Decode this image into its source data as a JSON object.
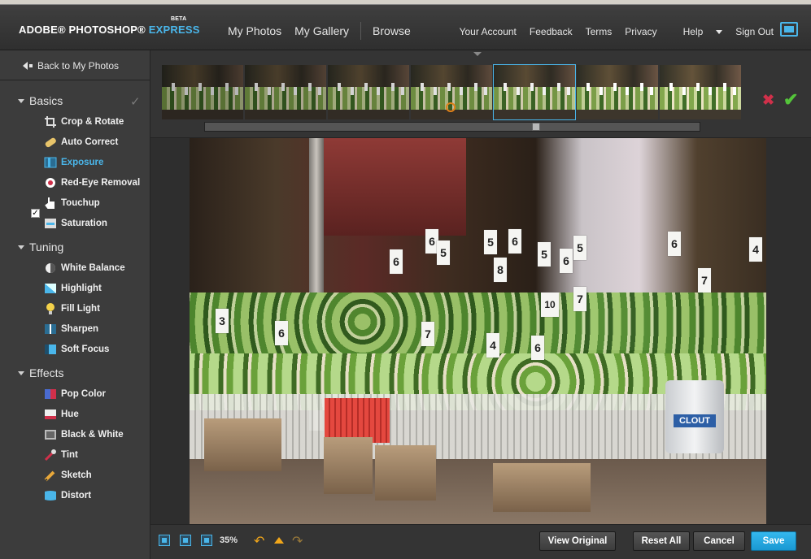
{
  "header": {
    "logo_main": "ADOBE® PHOTOSHOP®",
    "logo_express": "EXPRESS",
    "logo_beta": "BETA",
    "nav": [
      "My Photos",
      "My Gallery",
      "Browse"
    ],
    "links": [
      "Your Account",
      "Feedback",
      "Terms",
      "Privacy",
      "Help",
      "Sign Out"
    ]
  },
  "sidebar": {
    "back": "Back to My Photos",
    "sections": [
      {
        "title": "Basics",
        "tools": [
          "Crop & Rotate",
          "Auto Correct",
          "Exposure",
          "Red-Eye Removal",
          "Touchup",
          "Saturation"
        ]
      },
      {
        "title": "Tuning",
        "tools": [
          "White Balance",
          "Highlight",
          "Fill Light",
          "Sharpen",
          "Soft Focus"
        ]
      },
      {
        "title": "Effects",
        "tools": [
          "Pop Color",
          "Hue",
          "Black & White",
          "Tint",
          "Sketch",
          "Distort"
        ]
      }
    ],
    "active_tool": "Exposure",
    "checked_mark": "✓"
  },
  "strip": {
    "thumb_count": 7,
    "selected_index": 4
  },
  "photo": {
    "bucket_label": "CLOUT",
    "signs": [
      "3",
      "6",
      "6",
      "5",
      "5",
      "6",
      "8",
      "5",
      "6",
      "5",
      "6",
      "7",
      "4",
      "6",
      "10",
      "7",
      "4",
      "6",
      "7"
    ]
  },
  "bottom": {
    "zoom": "35%",
    "buttons": {
      "view_original": "View Original",
      "reset_all": "Reset All",
      "cancel": "Cancel",
      "save": "Save"
    }
  },
  "colors": {
    "accent": "#4ab6ea",
    "save": "#1fa5e0",
    "reject": "#d0304a",
    "accept": "#54c43a",
    "undo": "#f2a71a"
  }
}
